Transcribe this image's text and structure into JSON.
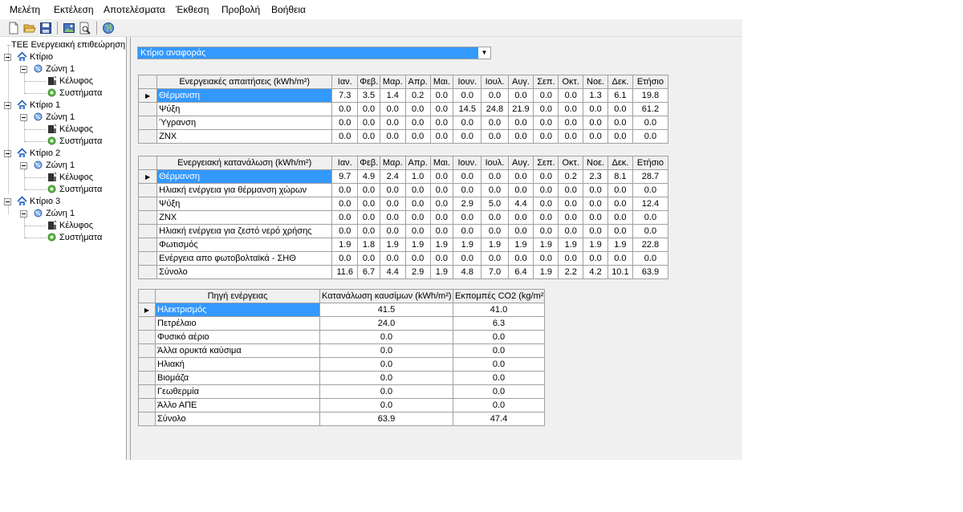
{
  "menu": [
    "Μελέτη",
    "Εκτέλεση",
    "Αποτελέσματα",
    "Έκθεση",
    "Προβολή",
    "Βοήθεια"
  ],
  "toolbar": [
    "new-icon",
    "open-icon",
    "save-icon",
    "image-icon",
    "print-preview-icon",
    "globe-icon"
  ],
  "tree": {
    "root": "ΤΕΕ Ενεργειακή επιθεώρηση",
    "buildings": [
      {
        "label": "Κτίριο",
        "zone": "Ζώνη 1",
        "shell": "Κέλυφος",
        "systems": "Συστήματα"
      },
      {
        "label": "Κτίριο 1",
        "zone": "Ζώνη 1",
        "shell": "Κέλυφος",
        "systems": "Συστήματα"
      },
      {
        "label": "Κτίριο 2",
        "zone": "Ζώνη 1",
        "shell": "Κέλυφος",
        "systems": "Συστήματα"
      },
      {
        "label": "Κτίριο 3",
        "zone": "Ζώνη 1",
        "shell": "Κέλυφος",
        "systems": "Συστήματα"
      }
    ]
  },
  "combo": {
    "value": "Κτίριο αναφοράς"
  },
  "months": [
    "Ιαν.",
    "Φεβ.",
    "Μαρ.",
    "Απρ.",
    "Μαι.",
    "Ιουν.",
    "Ιουλ.",
    "Αυγ.",
    "Σεπ.",
    "Οκτ.",
    "Νοε.",
    "Δεκ.",
    "Ετήσιο"
  ],
  "demand": {
    "header": "Ενεργειακές απαιτήσεις (kWh/m²)",
    "rows": [
      {
        "label": "Θέρμανση",
        "values": [
          "7.3",
          "3.5",
          "1.4",
          "0.2",
          "0.0",
          "0.0",
          "0.0",
          "0.0",
          "0.0",
          "0.0",
          "1.3",
          "6.1",
          "19.8"
        ]
      },
      {
        "label": "Ψύξη",
        "values": [
          "0.0",
          "0.0",
          "0.0",
          "0.0",
          "0.0",
          "14.5",
          "24.8",
          "21.9",
          "0.0",
          "0.0",
          "0.0",
          "0.0",
          "61.2"
        ]
      },
      {
        "label": "Ύγρανση",
        "values": [
          "0.0",
          "0.0",
          "0.0",
          "0.0",
          "0.0",
          "0.0",
          "0.0",
          "0.0",
          "0.0",
          "0.0",
          "0.0",
          "0.0",
          "0.0"
        ]
      },
      {
        "label": "ΖΝΧ",
        "values": [
          "0.0",
          "0.0",
          "0.0",
          "0.0",
          "0.0",
          "0.0",
          "0.0",
          "0.0",
          "0.0",
          "0.0",
          "0.0",
          "0.0",
          "0.0"
        ]
      }
    ]
  },
  "consumption": {
    "header": "Ενεργειακή κατανάλωση (kWh/m²)",
    "rows": [
      {
        "label": "Θέρμανση",
        "values": [
          "9.7",
          "4.9",
          "2.4",
          "1.0",
          "0.0",
          "0.0",
          "0.0",
          "0.0",
          "0.0",
          "0.2",
          "2.3",
          "8.1",
          "28.7"
        ]
      },
      {
        "label": "Ηλιακή ενέργεια για θέρμανση χώρων",
        "values": [
          "0.0",
          "0.0",
          "0.0",
          "0.0",
          "0.0",
          "0.0",
          "0.0",
          "0.0",
          "0.0",
          "0.0",
          "0.0",
          "0.0",
          "0.0"
        ]
      },
      {
        "label": "Ψύξη",
        "values": [
          "0.0",
          "0.0",
          "0.0",
          "0.0",
          "0.0",
          "2.9",
          "5.0",
          "4.4",
          "0.0",
          "0.0",
          "0.0",
          "0.0",
          "12.4"
        ]
      },
      {
        "label": "ΖΝΧ",
        "values": [
          "0.0",
          "0.0",
          "0.0",
          "0.0",
          "0.0",
          "0.0",
          "0.0",
          "0.0",
          "0.0",
          "0.0",
          "0.0",
          "0.0",
          "0.0"
        ]
      },
      {
        "label": "Ηλιακή ενέργεια για ζεστό νερό χρήσης",
        "values": [
          "0.0",
          "0.0",
          "0.0",
          "0.0",
          "0.0",
          "0.0",
          "0.0",
          "0.0",
          "0.0",
          "0.0",
          "0.0",
          "0.0",
          "0.0"
        ]
      },
      {
        "label": "Φωτισμός",
        "values": [
          "1.9",
          "1.8",
          "1.9",
          "1.9",
          "1.9",
          "1.9",
          "1.9",
          "1.9",
          "1.9",
          "1.9",
          "1.9",
          "1.9",
          "22.8"
        ]
      },
      {
        "label": "Ενέργεια απο φωτοβολταϊκά - ΣΗΘ",
        "values": [
          "0.0",
          "0.0",
          "0.0",
          "0.0",
          "0.0",
          "0.0",
          "0.0",
          "0.0",
          "0.0",
          "0.0",
          "0.0",
          "0.0",
          "0.0"
        ]
      },
      {
        "label": "Σύνολο",
        "values": [
          "11.6",
          "6.7",
          "4.4",
          "2.9",
          "1.9",
          "4.8",
          "7.0",
          "6.4",
          "1.9",
          "2.2",
          "4.2",
          "10.1",
          "63.9"
        ]
      }
    ]
  },
  "sources": {
    "headers": [
      "Πηγή ενέργειας",
      "Κατανάλωση καυσίμων (kWh/m²)",
      "Εκπομπές CO2 (kg/m²)"
    ],
    "rows": [
      {
        "label": "Ηλεκτρισμός",
        "fuel": "41.5",
        "co2": "41.0"
      },
      {
        "label": "Πετρέλαιο",
        "fuel": "24.0",
        "co2": "6.3"
      },
      {
        "label": "Φυσικό αέριο",
        "fuel": "0.0",
        "co2": "0.0"
      },
      {
        "label": "Άλλα ορυκτά καύσιμα",
        "fuel": "0.0",
        "co2": "0.0"
      },
      {
        "label": "Ηλιακή",
        "fuel": "0.0",
        "co2": "0.0"
      },
      {
        "label": "Βιομάζα",
        "fuel": "0.0",
        "co2": "0.0"
      },
      {
        "label": "Γεωθερμία",
        "fuel": "0.0",
        "co2": "0.0"
      },
      {
        "label": "Άλλο ΑΠΕ",
        "fuel": "0.0",
        "co2": "0.0"
      },
      {
        "label": "Σύνολο",
        "fuel": "63.9",
        "co2": "47.4"
      }
    ]
  },
  "colors": {
    "selection": "#3399ff",
    "background": "#f0f0f0"
  }
}
